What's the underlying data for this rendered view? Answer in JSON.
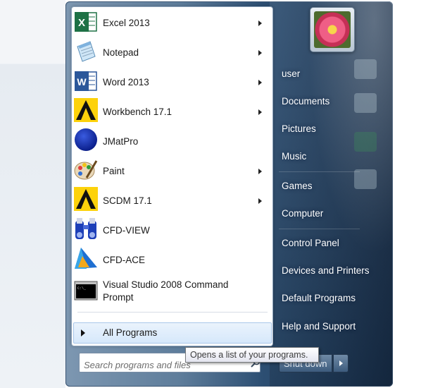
{
  "programs": [
    {
      "name": "Excel 2013",
      "icon": "excel-icon",
      "submenu": true
    },
    {
      "name": "Notepad",
      "icon": "notepad-icon",
      "submenu": true
    },
    {
      "name": "Word 2013",
      "icon": "word-icon",
      "submenu": true
    },
    {
      "name": "Workbench 17.1",
      "icon": "ansys-workbench-icon",
      "submenu": true
    },
    {
      "name": "JMatPro",
      "icon": "jmatpro-icon",
      "submenu": false
    },
    {
      "name": "Paint",
      "icon": "paint-icon",
      "submenu": true
    },
    {
      "name": "SCDM 17.1",
      "icon": "ansys-scdm-icon",
      "submenu": true
    },
    {
      "name": "CFD-VIEW",
      "icon": "cfd-view-icon",
      "submenu": false
    },
    {
      "name": "CFD-ACE",
      "icon": "cfd-ace-icon",
      "submenu": false
    },
    {
      "name": "Visual Studio 2008 Command Prompt",
      "icon": "command-prompt-icon",
      "submenu": false
    }
  ],
  "all_programs": "All Programs",
  "search": {
    "placeholder": "Search programs and files"
  },
  "tooltip": "Opens a list of your programs.",
  "right_pane": {
    "user": "user",
    "documents": "Documents",
    "pictures": "Pictures",
    "music": "Music",
    "games": "Games",
    "computer": "Computer",
    "control_panel": "Control Panel",
    "devices_printers": "Devices and Printers",
    "default_programs": "Default Programs",
    "help_support": "Help and Support"
  },
  "shutdown": "Shut down",
  "colors": {
    "excel": "#1e7145",
    "word": "#2b579a",
    "highlight": "#d6e8fb",
    "menu_glass": "#2d4f73"
  }
}
